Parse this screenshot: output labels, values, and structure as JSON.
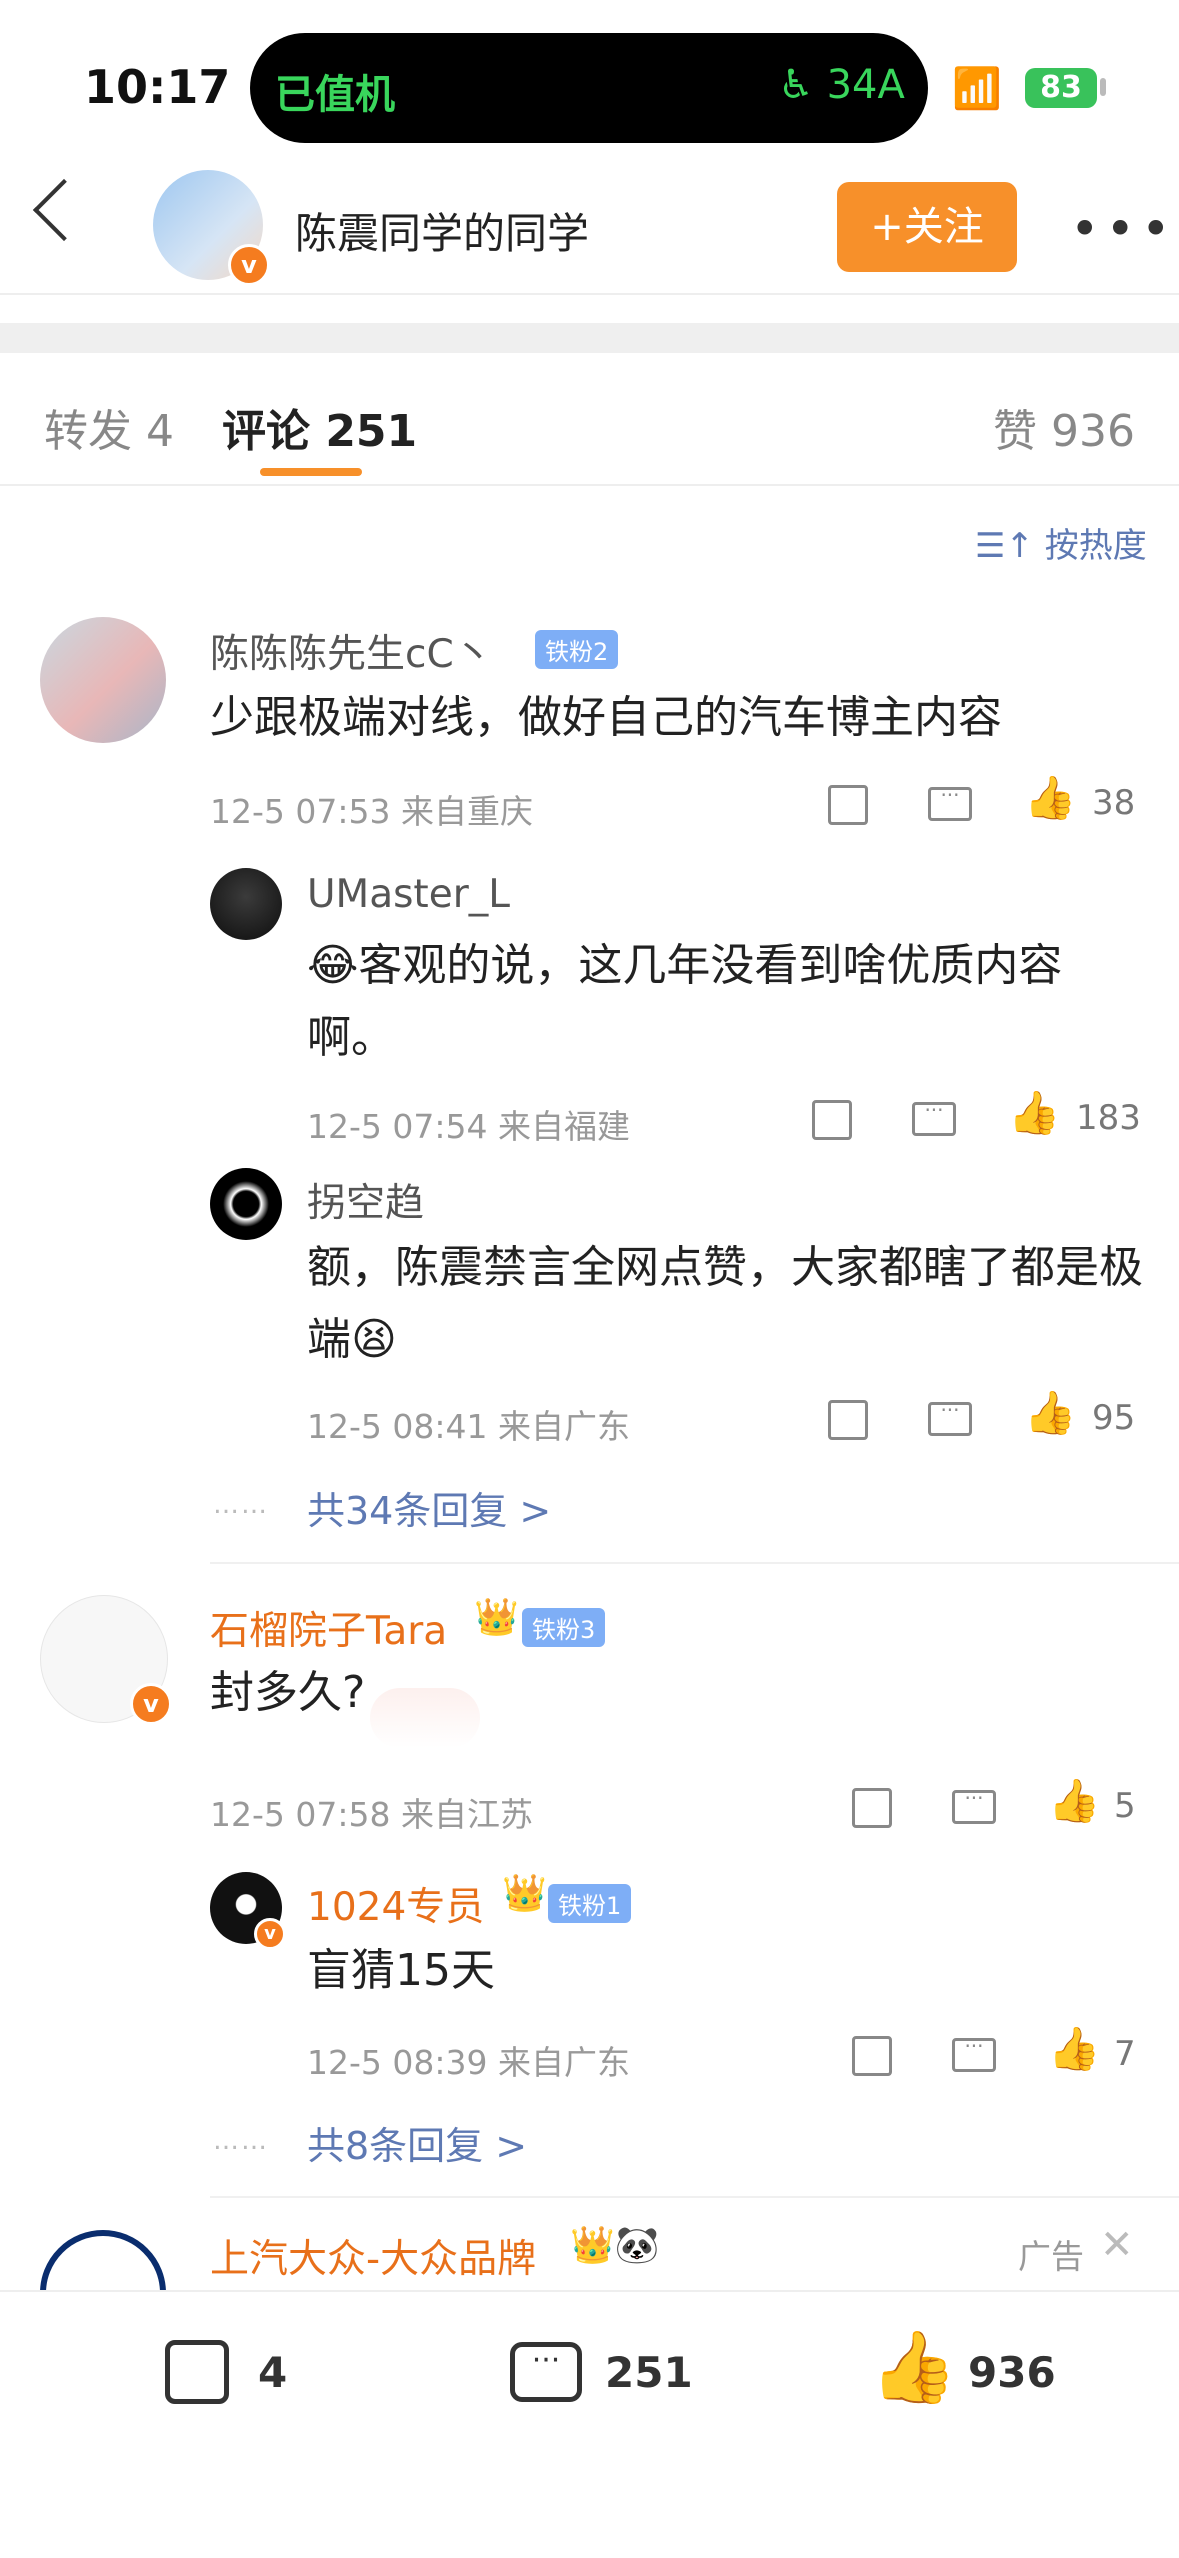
{
  "status": {
    "time": "10:17",
    "island_text": "已值机",
    "seat": "34A",
    "battery": "83"
  },
  "nav": {
    "title": "陈震同学的同学",
    "follow_label": "+关注",
    "more": "•••"
  },
  "tabs": {
    "repost": "转发 4",
    "comment": "评论 251",
    "like": "赞 936"
  },
  "sort_label": "按热度",
  "comments": [
    {
      "name": "陈陈陈先生cC丶",
      "badge": "铁粉2",
      "content": "少跟极端对线，做好自己的汽车博主内容",
      "meta": "12-5 07:53  来自重庆",
      "likes": "38",
      "replies": [
        {
          "name": "UMaster_L",
          "content": "客观的说，这几年没看到啥优质内容啊。",
          "emoji": "😂",
          "meta": "12-5 07:54  来自福建",
          "likes": "183"
        },
        {
          "name": "拐空趋",
          "content": "额，陈震禁言全网点赞，大家都瞎了都是极端",
          "emoji": "😫",
          "meta": "12-5 08:41  来自广东",
          "likes": "95"
        }
      ],
      "more_replies": "共34条回复 >"
    },
    {
      "name": "石榴院子Tara",
      "badge": "铁粉3",
      "content": "封多久?",
      "meta": "12-5 07:58  来自江苏",
      "likes": "5",
      "replies": [
        {
          "name": "1024专员",
          "badge": "铁粉1",
          "content": "盲猜15天",
          "meta": "12-5 08:39  来自广东",
          "likes": "7"
        }
      ],
      "more_replies": "共8条回复 >"
    },
    {
      "name": "上汽大众-大众品牌",
      "ad_label": "广告"
    }
  ],
  "bottom": {
    "repost": "4",
    "comment": "251",
    "like": "936"
  },
  "colors": {
    "accent": "#f7902a",
    "link": "#5e79b3",
    "vip_name": "#e8701a",
    "island_green": "#39d65c"
  }
}
